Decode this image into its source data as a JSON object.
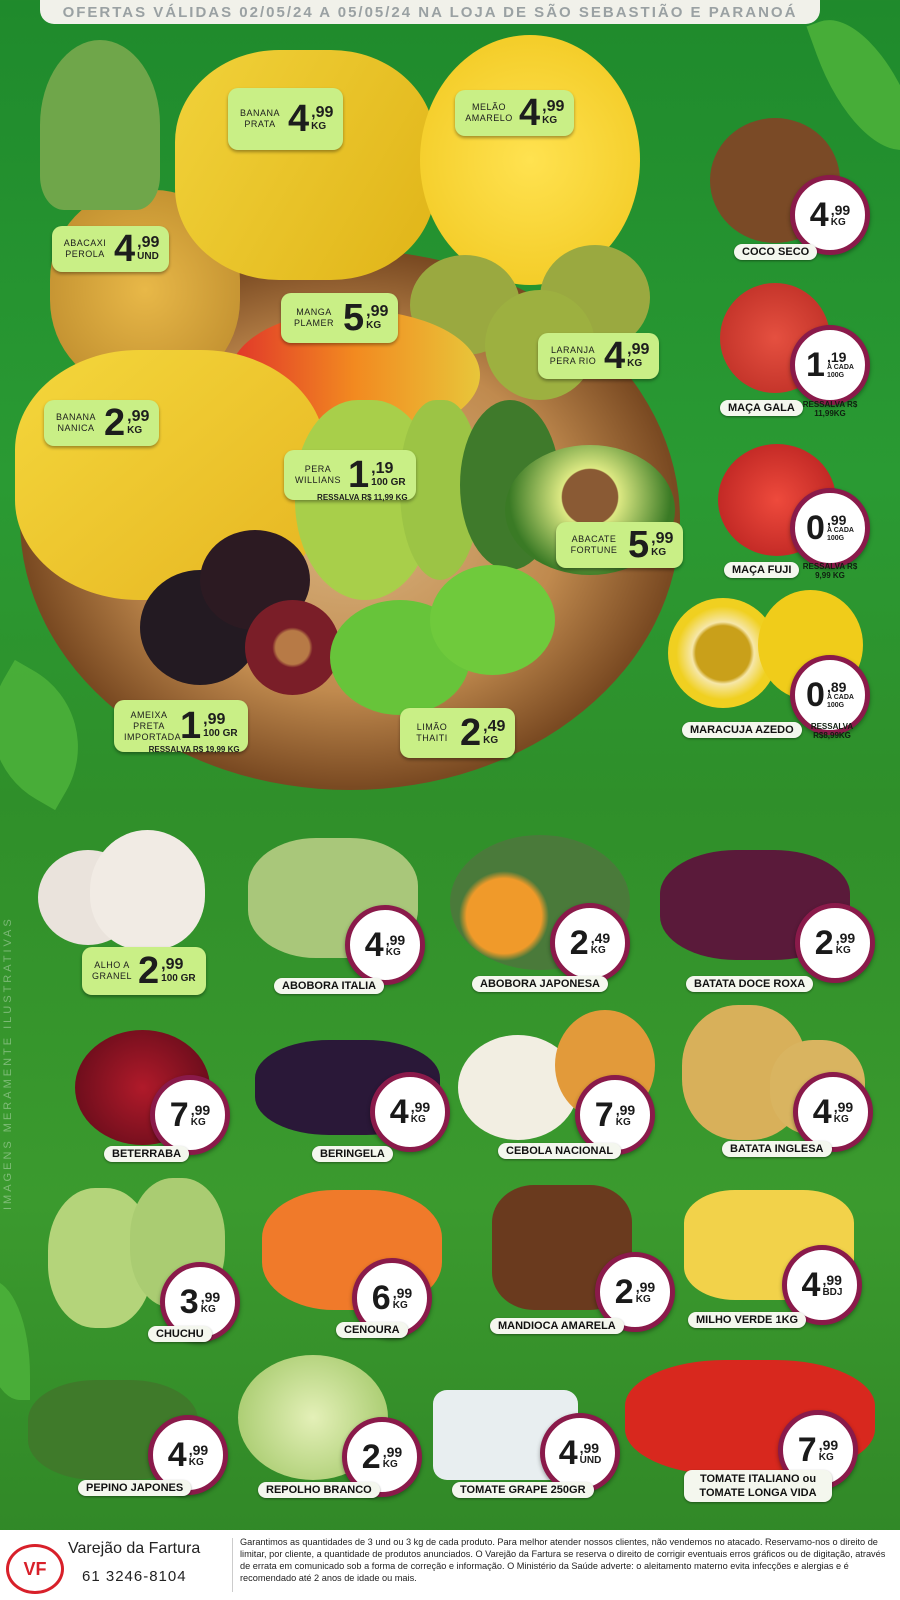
{
  "header": {
    "text": "OFERTAS VÁLIDAS 02/05/24 A 05/05/24 NA LOJA DE SÃO SEBASTIÃO E PARANOÁ"
  },
  "side_note": "IMAGENS MERAMENTE ILUSTRATIVAS",
  "colors": {
    "tag_bg": "#c9ef86",
    "badge_ring": "#8a1a4a",
    "background": "#2a9a33"
  },
  "tags": {
    "banana_prata": {
      "name": "BANANA PRATA",
      "int": "4",
      "cents": ",99",
      "unit": "KG"
    },
    "melao": {
      "name": "MELÃO AMARELO",
      "int": "4",
      "cents": ",99",
      "unit": "KG"
    },
    "abacaxi": {
      "name": "ABACAXI PEROLA",
      "int": "4",
      "cents": ",99",
      "unit": "UND"
    },
    "manga": {
      "name": "MANGA PLAMER",
      "int": "5",
      "cents": ",99",
      "unit": "KG"
    },
    "laranja": {
      "name": "LARANJA PERA RIO",
      "int": "4",
      "cents": ",99",
      "unit": "KG"
    },
    "banana_nanica": {
      "name": "BANANA NANICA",
      "int": "2",
      "cents": ",99",
      "unit": "KG"
    },
    "pera": {
      "name": "PERA WILLIANS",
      "int": "1",
      "cents": ",19",
      "unit": "100 GR",
      "resale": "RESSALVA R$ 11,99 KG"
    },
    "abacate": {
      "name": "ABACATE FORTUNE",
      "int": "5",
      "cents": ",99",
      "unit": "KG"
    },
    "ameixa": {
      "name": "AMEIXA PRETA IMPORTADA",
      "int": "1",
      "cents": ",99",
      "unit": "100 GR",
      "resale": "RESSALVA R$ 19,99 KG"
    },
    "limao": {
      "name": "LIMÃO THAITI",
      "int": "2",
      "cents": ",49",
      "unit": "KG"
    },
    "alho": {
      "name": "ALHO A GRANEL",
      "int": "2",
      "cents": ",99",
      "unit": "100 GR"
    }
  },
  "right_items": [
    {
      "label": "COCO SECO",
      "int": "4",
      "cents": ",99",
      "unit": "KG",
      "extra": "",
      "resale": ""
    },
    {
      "label": "MAÇA GALA",
      "int": "1",
      "cents": ",19",
      "unit": "A CADA",
      "extra": "100G",
      "resale": "RESSALVA R$ 11,99KG"
    },
    {
      "label": "MAÇA FUJI",
      "int": "0",
      "cents": ",99",
      "unit": "A CADA",
      "extra": "100G",
      "resale": "RESSALVA R$ 9,99 KG"
    },
    {
      "label": "MARACUJA AZEDO",
      "int": "0",
      "cents": ",89",
      "unit": "A CADA",
      "extra": "100G",
      "resale": "RESSALVA R$8,99KG"
    }
  ],
  "grid_items": [
    {
      "label": "ABOBORA ITALIA",
      "int": "4",
      "cents": ",99",
      "unit": "KG"
    },
    {
      "label": "ABOBORA JAPONESA",
      "int": "2",
      "cents": ",49",
      "unit": "KG"
    },
    {
      "label": "BATATA DOCE ROXA",
      "int": "2",
      "cents": ",99",
      "unit": "KG"
    },
    {
      "label": "BETERRABA",
      "int": "7",
      "cents": ",99",
      "unit": "KG"
    },
    {
      "label": "BERINGELA",
      "int": "4",
      "cents": ",99",
      "unit": "KG"
    },
    {
      "label": "CEBOLA NACIONAL",
      "int": "7",
      "cents": ",99",
      "unit": "KG"
    },
    {
      "label": "BATATA INGLESA",
      "int": "4",
      "cents": ",99",
      "unit": "KG"
    },
    {
      "label": "CHUCHU",
      "int": "3",
      "cents": ",99",
      "unit": "KG"
    },
    {
      "label": "CENOURA",
      "int": "6",
      "cents": ",99",
      "unit": "KG"
    },
    {
      "label": "MANDIOCA AMARELA",
      "int": "2",
      "cents": ",99",
      "unit": "KG"
    },
    {
      "label": "MILHO VERDE 1KG",
      "int": "4",
      "cents": ",99",
      "unit": "BDJ"
    },
    {
      "label": "PEPINO JAPONES",
      "int": "4",
      "cents": ",99",
      "unit": "KG"
    },
    {
      "label": "REPOLHO BRANCO",
      "int": "2",
      "cents": ",99",
      "unit": "KG"
    },
    {
      "label": "TOMATE GRAPE 250GR",
      "int": "4",
      "cents": ",99",
      "unit": "UND"
    },
    {
      "label": "TOMATE ITALIANO ou TOMATE LONGA VIDA",
      "int": "7",
      "cents": ",99",
      "unit": "KG"
    }
  ],
  "footer": {
    "logo": "VF",
    "store": "Varejão da Fartura",
    "phone": "61 3246-8104",
    "disclaimer": "Garantimos as quantidades de 3 und ou 3 kg de cada produto. Para melhor atender nossos clientes, não vendemos no atacado. Reservamo-nos o direito de limitar, por cliente, a quantidade de produtos anunciados. O Varejão da Fartura se reserva o direito de corrigir eventuais erros gráficos ou de digitação, através de errata em comunicado sob a forma de correção e informação. O Ministério da Saúde adverte: o aleitamento materno evita infecções e alergias e é recomendado até 2 anos de idade ou mais."
  }
}
